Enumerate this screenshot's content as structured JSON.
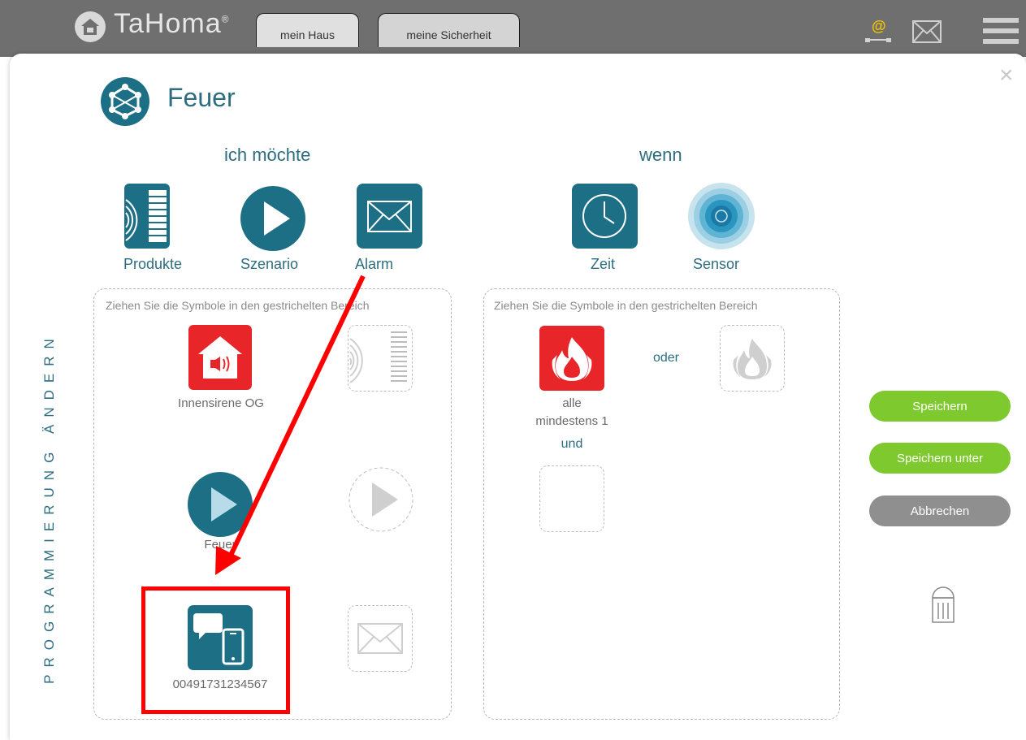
{
  "topbar": {
    "brand": "TaHoma",
    "brand_mark": "®",
    "tabs": [
      {
        "label": "mein Haus"
      },
      {
        "label": "meine Sicherheit"
      }
    ],
    "icons": [
      "contact-at-icon",
      "mail-icon",
      "hamburger-menu-icon"
    ]
  },
  "modal": {
    "title": "Feuer",
    "close_label": "×",
    "side_label": "PROGRAMMIERUNG ÄNDERN",
    "action_header": "ich möchte",
    "condition_header": "wenn",
    "action_tools": [
      {
        "label": "Produkte",
        "icon": "products-icon"
      },
      {
        "label": "Szenario",
        "icon": "play-icon"
      },
      {
        "label": "Alarm",
        "icon": "envelope-icon"
      }
    ],
    "condition_tools": [
      {
        "label": "Zeit",
        "icon": "clock-icon"
      },
      {
        "label": "Sensor",
        "icon": "sensor-icon"
      }
    ],
    "action_zone": {
      "hint": "Ziehen Sie die Symbole in den gestrichelten Bereich",
      "items": [
        {
          "label": "Innensirene OG",
          "icon": "siren-icon"
        },
        {
          "label": "Feuer",
          "icon": "play-icon"
        },
        {
          "label": "00491731234567",
          "icon": "sms-phone-icon"
        }
      ]
    },
    "condition_zone": {
      "hint": "Ziehen Sie die Symbole in den gestrichelten Bereich",
      "sensor_line1": "alle",
      "sensor_line2": "mindestens 1",
      "or_label": "oder",
      "and_label": "und"
    },
    "buttons": {
      "save": "Speichern",
      "save_as": "Speichern unter",
      "cancel": "Abbrechen"
    },
    "colors": {
      "teal": "#1d6f86",
      "green": "#7ec92e",
      "red": "#e8262a",
      "annotation": "#ff0000"
    }
  }
}
